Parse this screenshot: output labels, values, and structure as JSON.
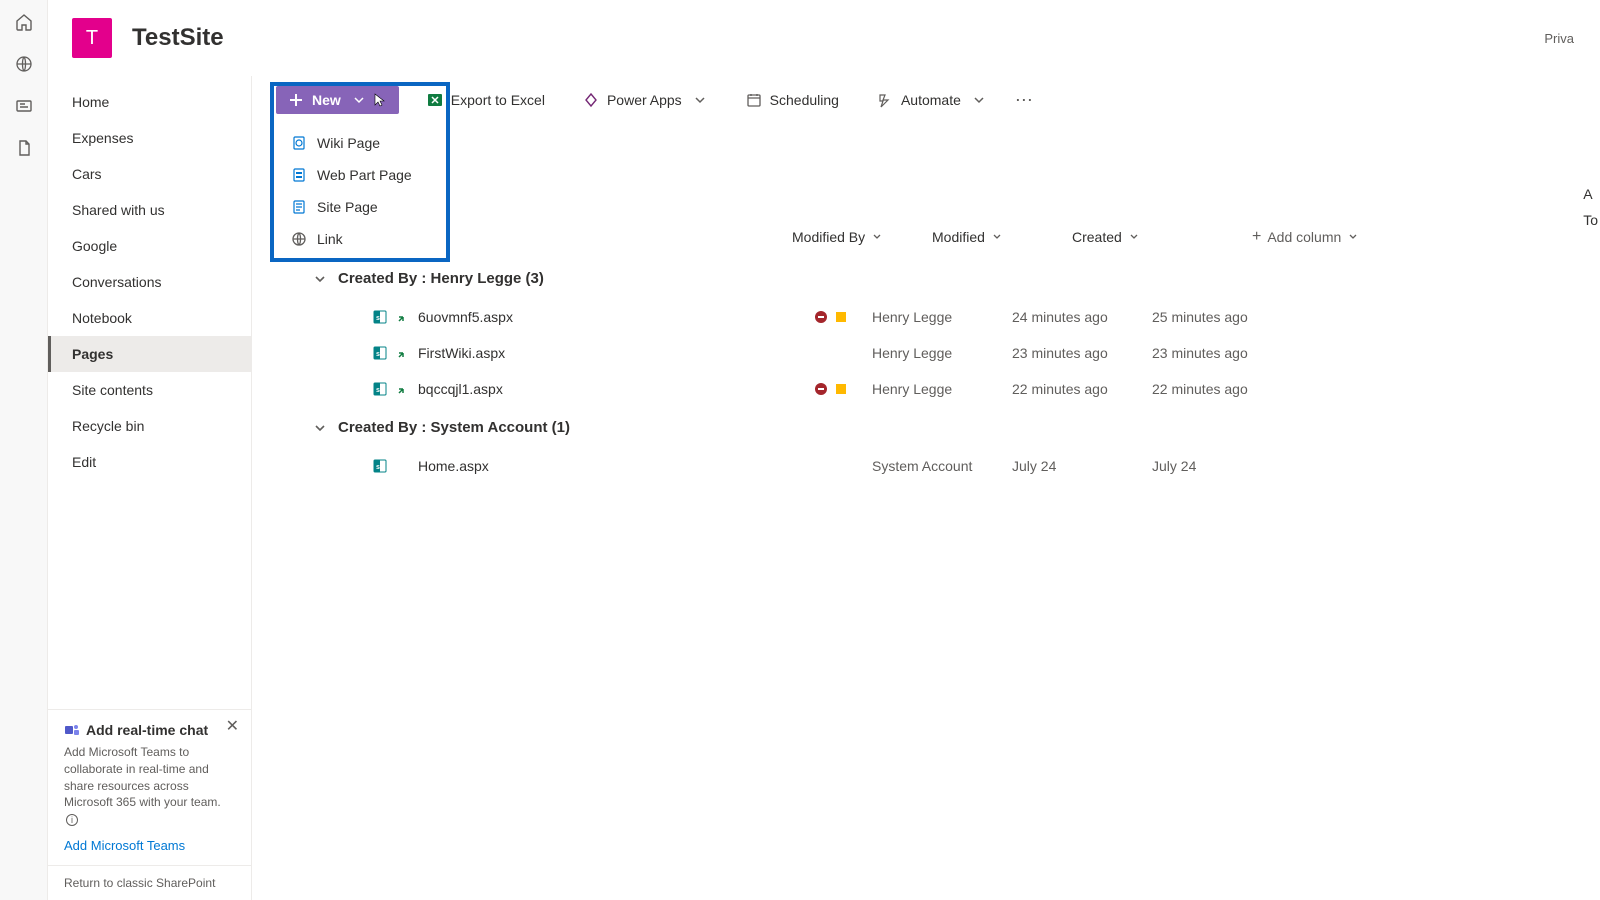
{
  "site": {
    "logo_letter": "T",
    "title": "TestSite",
    "privacy": "Priva"
  },
  "appbar_icons": [
    "home-icon",
    "globe-icon",
    "news-icon",
    "file-icon"
  ],
  "nav": {
    "items": [
      {
        "label": "Home"
      },
      {
        "label": "Expenses"
      },
      {
        "label": "Cars"
      },
      {
        "label": "Shared with us"
      },
      {
        "label": "Google"
      },
      {
        "label": "Conversations"
      },
      {
        "label": "Notebook"
      },
      {
        "label": "Pages",
        "active": true
      },
      {
        "label": "Site contents"
      },
      {
        "label": "Recycle bin"
      },
      {
        "label": "Edit"
      }
    ]
  },
  "teams_promo": {
    "title": "Add real-time chat",
    "body": "Add Microsoft Teams to collaborate in real-time and share resources across Microsoft 365 with your team.",
    "link": "Add Microsoft Teams"
  },
  "classic_link": "Return to classic SharePoint",
  "toolbar": {
    "new_label": "New",
    "export_label": "Export to Excel",
    "powerapps_label": "Power Apps",
    "scheduling_label": "Scheduling",
    "automate_label": "Automate"
  },
  "new_menu": {
    "items": [
      {
        "label": "Wiki Page"
      },
      {
        "label": "Web Part Page"
      },
      {
        "label": "Site Page"
      },
      {
        "label": "Link"
      }
    ]
  },
  "columns": {
    "modified_by": "Modified By",
    "modified": "Modified",
    "created": "Created",
    "add": "Add column"
  },
  "right_stub": {
    "a": "A",
    "t": "To"
  },
  "groups": [
    {
      "title": "Created By : Henry Legge (3)",
      "rows": [
        {
          "name": "6uovmnf5.aspx",
          "person": "Henry Legge",
          "modified": "24 minutes ago",
          "created": "25 minutes ago",
          "status": true,
          "checkout": true
        },
        {
          "name": "FirstWiki.aspx",
          "person": "Henry Legge",
          "modified": "23 minutes ago",
          "created": "23 minutes ago",
          "status": false,
          "checkout": true
        },
        {
          "name": "bqccqjl1.aspx",
          "person": "Henry Legge",
          "modified": "22 minutes ago",
          "created": "22 minutes ago",
          "status": true,
          "checkout": true
        }
      ]
    },
    {
      "title": "Created By : System Account (1)",
      "rows": [
        {
          "name": "Home.aspx",
          "person": "System Account",
          "modified": "July 24",
          "created": "July 24",
          "status": false,
          "checkout": false
        }
      ]
    }
  ]
}
